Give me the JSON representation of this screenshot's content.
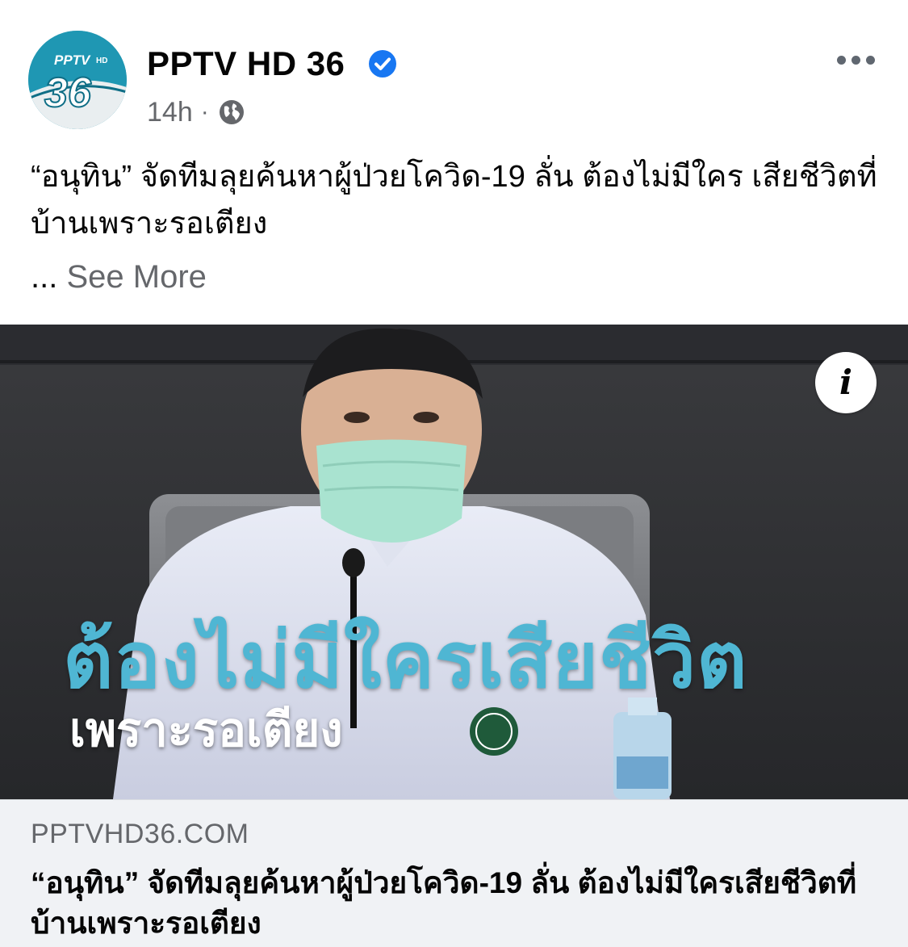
{
  "colors": {
    "verified": "#1877f2",
    "secondary_text": "#65676b",
    "overlay_text": "#4fb6d3",
    "link_bg": "#f0f2f5"
  },
  "header": {
    "page_name": "PPTV HD 36",
    "avatar_logo_text": "PPTV HD 36",
    "verified_icon": "verified-badge-icon",
    "timestamp": "14h",
    "separator": "·",
    "audience_icon": "globe-icon",
    "more_icon": "more-horizontal-icon"
  },
  "post": {
    "caption": "“อนุทิน” จัดทีมลุยค้นหาผู้ป่วยโควิด-19 ลั่น ต้องไม่มีใคร เสียชีวิตที่บ้านเพราะรอเตียง",
    "ellipsis": "...",
    "see_more": "See More"
  },
  "image": {
    "overlay_main": "ต้องไม่มีใครเสียชีวิต",
    "overlay_sub": "เพราะรอเตียง",
    "info_icon": "info-icon",
    "info_glyph": "i"
  },
  "link_preview": {
    "domain": "PPTVHD36.COM",
    "title": "“อนุทิน” จัดทีมลุยค้นหาผู้ป่วยโควิด-19 ลั่น ต้องไม่มีใครเสียชีวิตที่บ้านเพราะรอเตียง"
  }
}
